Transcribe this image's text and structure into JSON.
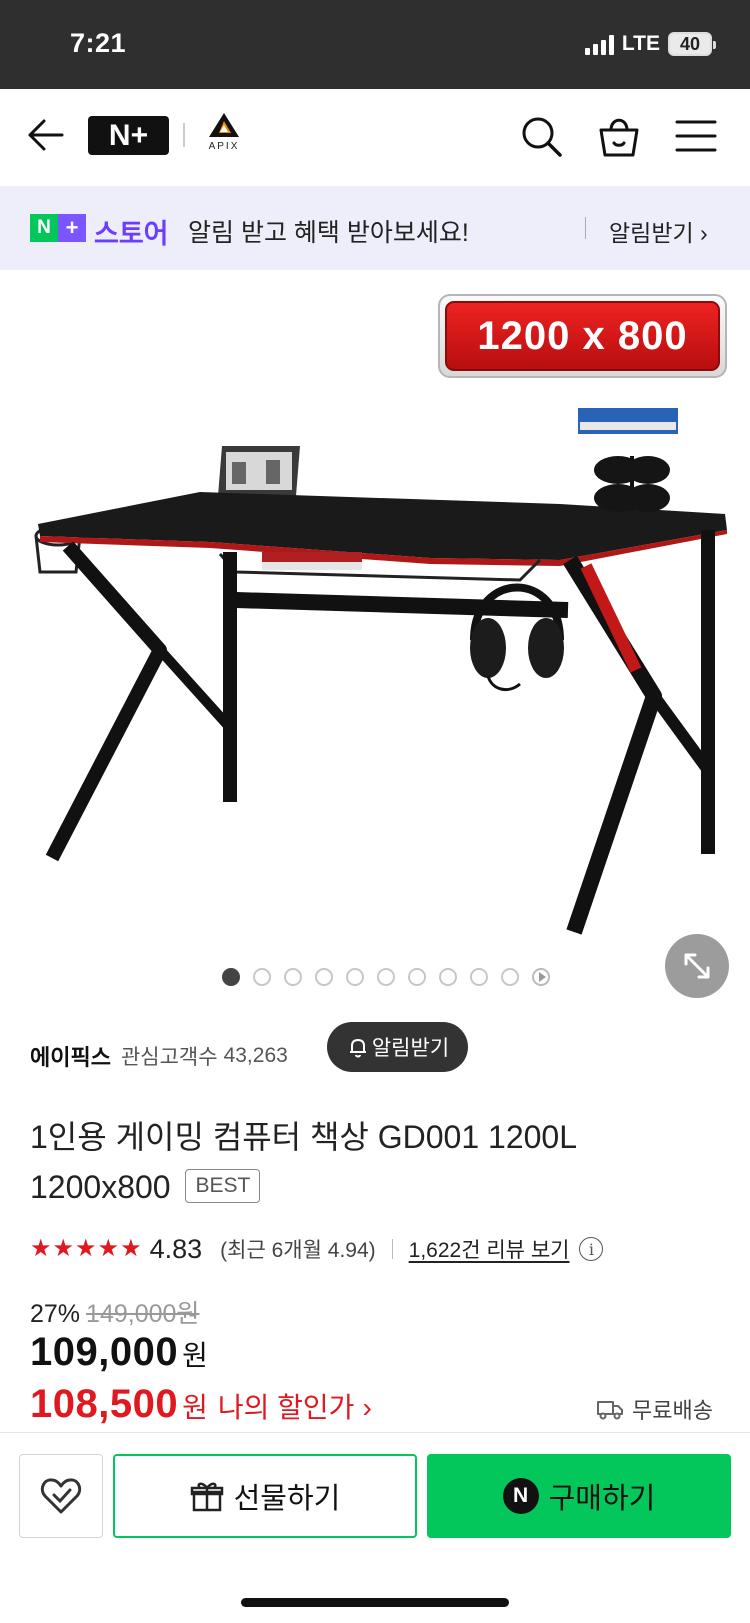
{
  "status_bar": {
    "time": "7:21",
    "network": "LTE",
    "battery": "40"
  },
  "nav": {
    "logo_text": "N+",
    "brand_logo_text": "APIX",
    "icons": [
      "back-arrow-icon",
      "search-icon",
      "shopping-bag-icon",
      "menu-icon"
    ]
  },
  "promo": {
    "badge_n": "N",
    "badge_plus": "+",
    "store_label": "스토어",
    "message": "알림 받고 혜택 받아보세요!",
    "cta": "알림받기 ›"
  },
  "hero": {
    "size_badge": "1200 x 800",
    "slide_count": 10,
    "active_slide": 1
  },
  "seller": {
    "name": "에이픽스",
    "fan_label": "관심고객수",
    "fan_count": "43,263",
    "notify_label": "알림받기"
  },
  "product": {
    "title": "1인용 게이밍 컴퓨터 책상 GD001 1200L 1200x800",
    "badge": "BEST",
    "rating": "4.83",
    "rating_recent": "(최근 6개월 4.94)",
    "review_link": "1,622건 리뷰 보기",
    "discount_pct": "27%",
    "original_price": "149,000원",
    "sale_price": "109,000",
    "sale_unit": "원",
    "my_price": "108,500",
    "my_unit": "원",
    "my_price_label": "나의 할인가",
    "shipping": "무료배송"
  },
  "bottom": {
    "gift_label": "선물하기",
    "buy_label": "구매하기",
    "buy_badge": "N"
  },
  "colors": {
    "naver_green": "#03c75a",
    "store_purple": "#6a3dff",
    "price_red": "#e0181f",
    "promo_bg": "#eeeefa"
  }
}
